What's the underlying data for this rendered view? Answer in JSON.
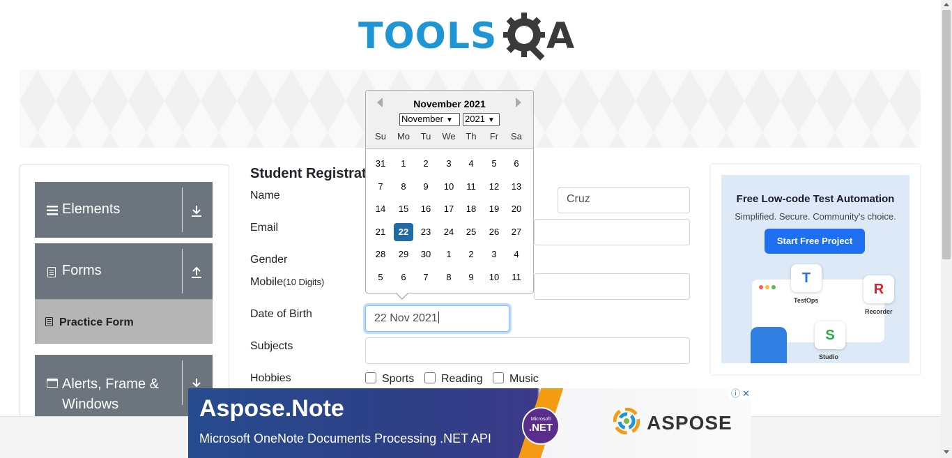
{
  "logo": {
    "tools": "TOOLS",
    "a": "A"
  },
  "banner": {
    "title": "Practice Form",
    "visible": "rm"
  },
  "sidebar": {
    "groups": [
      {
        "label": "Elements",
        "icon": "list-icon",
        "arrow": "download-arrow-icon"
      },
      {
        "label": "Forms",
        "icon": "document-icon",
        "arrow": "upload-arrow-icon"
      },
      {
        "label": "Alerts, Frame & Windows",
        "icon": "window-icon",
        "arrow": "download-arrow-icon"
      }
    ],
    "active_item": "Practice Form"
  },
  "form": {
    "title": "Student Registratio",
    "labels": {
      "name": "Name",
      "email": "Email",
      "gender": "Gender",
      "mobile": "Mobile",
      "mobile_hint": "(10 Digits)",
      "dob": "Date of Birth",
      "subjects": "Subjects",
      "hobbies": "Hobbies"
    },
    "last_name_value": "Cruz",
    "dob_value": "22 Nov 2021",
    "hobbies": [
      "Sports",
      "Reading",
      "Music"
    ]
  },
  "datepicker": {
    "title": "November 2021",
    "month_select": "November",
    "year_select": "2021",
    "weekdays": [
      "Su",
      "Mo",
      "Tu",
      "We",
      "Th",
      "Fr",
      "Sa"
    ],
    "weeks": [
      [
        "31",
        "1",
        "2",
        "3",
        "4",
        "5",
        "6"
      ],
      [
        "7",
        "8",
        "9",
        "10",
        "11",
        "12",
        "13"
      ],
      [
        "14",
        "15",
        "16",
        "17",
        "18",
        "19",
        "20"
      ],
      [
        "21",
        "22",
        "23",
        "24",
        "25",
        "26",
        "27"
      ],
      [
        "28",
        "29",
        "30",
        "1",
        "2",
        "3",
        "4"
      ],
      [
        "5",
        "6",
        "7",
        "8",
        "9",
        "10",
        "11"
      ]
    ],
    "selected": "22",
    "selected_color": "#216ba5"
  },
  "ad_right": {
    "headline": "Free Low-code Test Automation",
    "tagline": "Simplified. Secure. Community's choice.",
    "button": "Start Free Project",
    "badges": {
      "testops": "TestOps",
      "recorder": "Recorder",
      "studio": "Studio"
    }
  },
  "ad_bottom": {
    "title": "Aspose.Note",
    "subtitle": "Microsoft OneNote Documents Processing .NET API",
    "badge_top": "Microsoft",
    "badge_main": ".NET",
    "brand": "ASPOSE"
  },
  "colors": {
    "brand_blue": "#1e96d6",
    "sidebar_gray": "#6c757d",
    "active_item_bg": "#b5b5b5",
    "ad_button": "#1e6ff1"
  }
}
